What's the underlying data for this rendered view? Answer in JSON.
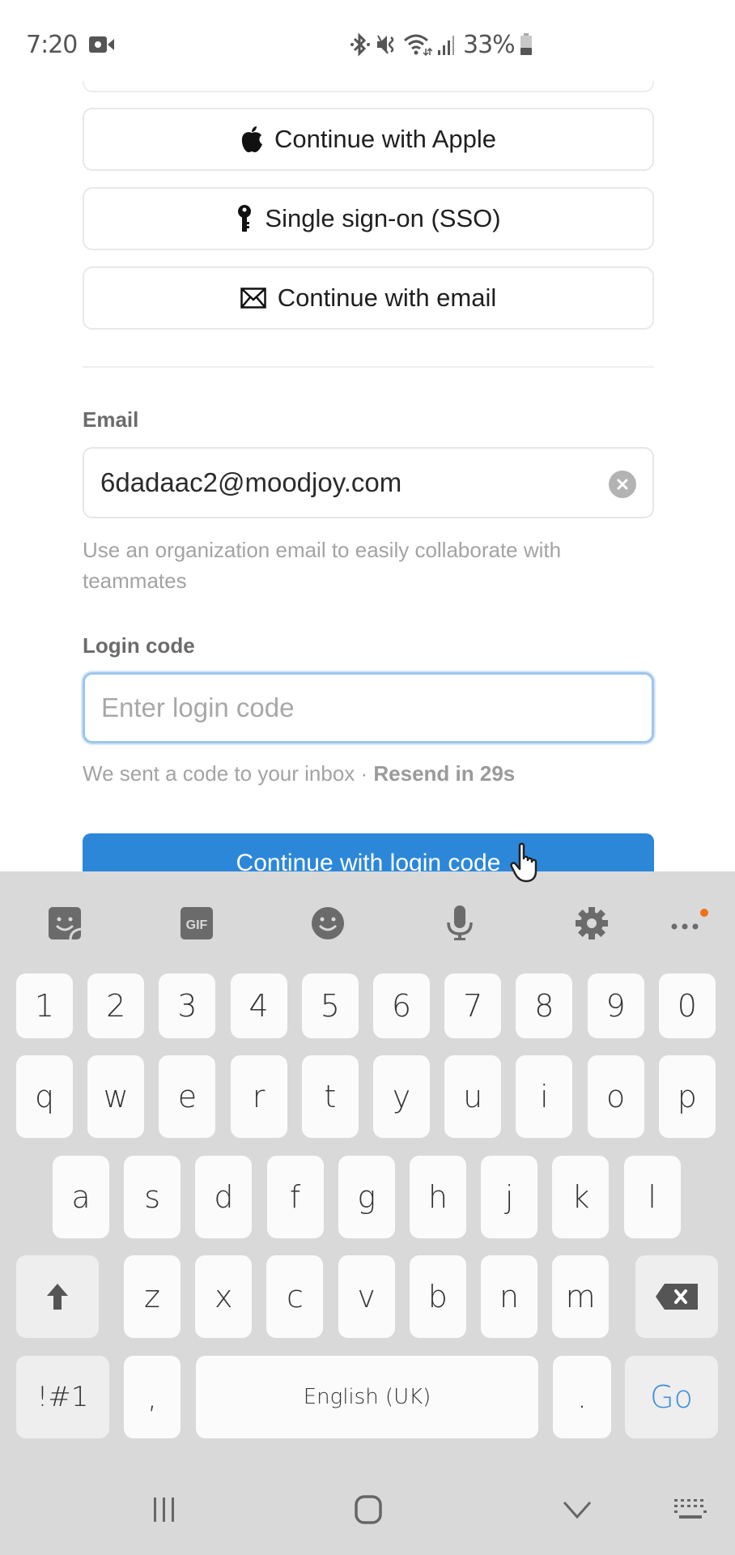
{
  "status_bar": {
    "time": "7:20",
    "battery_percent": "33%",
    "icons": [
      "screen-record-icon",
      "bluetooth-icon",
      "vibrate-icon",
      "wifi-icon",
      "signal-icon",
      "battery-icon"
    ]
  },
  "auth_options": [
    {
      "label": "Continue with Apple",
      "icon": "apple-icon"
    },
    {
      "label": "Single sign-on (SSO)",
      "icon": "key-icon"
    },
    {
      "label": "Continue with email",
      "icon": "envelope-icon"
    }
  ],
  "email_field": {
    "label": "Email",
    "value": "6dadaac2@moodjoy.com",
    "help_text": "Use an organization email to easily collaborate with teammates"
  },
  "login_code_field": {
    "label": "Login code",
    "placeholder": "Enter login code",
    "value": "",
    "hint_prefix": "We sent a code to your inbox · ",
    "hint_resend": "Resend in 29s"
  },
  "primary_button": {
    "label": "Continue with login code",
    "color": "#2d87d9"
  },
  "keyboard": {
    "toolbar": [
      "sticker-icon",
      "gif-icon",
      "emoji-icon",
      "microphone-icon",
      "settings-icon",
      "more-icon"
    ],
    "toolbar_gif_label": "GIF",
    "row_numbers": [
      "1",
      "2",
      "3",
      "4",
      "5",
      "6",
      "7",
      "8",
      "9",
      "0"
    ],
    "row_1": [
      "q",
      "w",
      "e",
      "r",
      "t",
      "y",
      "u",
      "i",
      "o",
      "p"
    ],
    "row_2": [
      "a",
      "s",
      "d",
      "f",
      "g",
      "h",
      "j",
      "k",
      "l"
    ],
    "row_3": [
      "z",
      "x",
      "c",
      "v",
      "b",
      "n",
      "m"
    ],
    "symbols_label": "!#1",
    "comma": ",",
    "space_label": "English (UK)",
    "period": ".",
    "action_label": "Go",
    "action_color": "#3a8fdc"
  },
  "nav_bar": [
    "recents-icon",
    "home-icon",
    "back-icon",
    "keyboard-hide-icon"
  ]
}
